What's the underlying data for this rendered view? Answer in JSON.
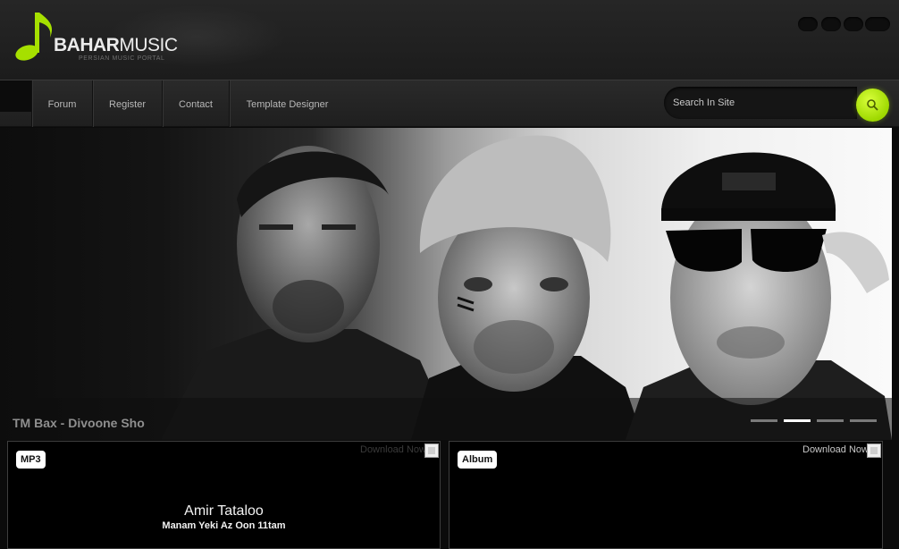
{
  "brand": {
    "name_bold": "BAHAR",
    "name_light": "MUSIC",
    "tagline": "PERSIAN MUSIC PORTAL",
    "accent": "#a6e000"
  },
  "nav": {
    "items": [
      "Forum",
      "Register",
      "Contact",
      "Template Designer"
    ]
  },
  "search": {
    "placeholder": "Search In Site"
  },
  "slider": {
    "caption": "TM Bax - Divoone Sho",
    "slide_count": 4,
    "active_slide": 2
  },
  "cards": [
    {
      "badge": "MP3",
      "download": "Download Now",
      "artist": "Amir Tataloo",
      "song": "Manam Yeki Az Oon 11tam"
    },
    {
      "badge": "Album",
      "download": "Download Now"
    }
  ]
}
